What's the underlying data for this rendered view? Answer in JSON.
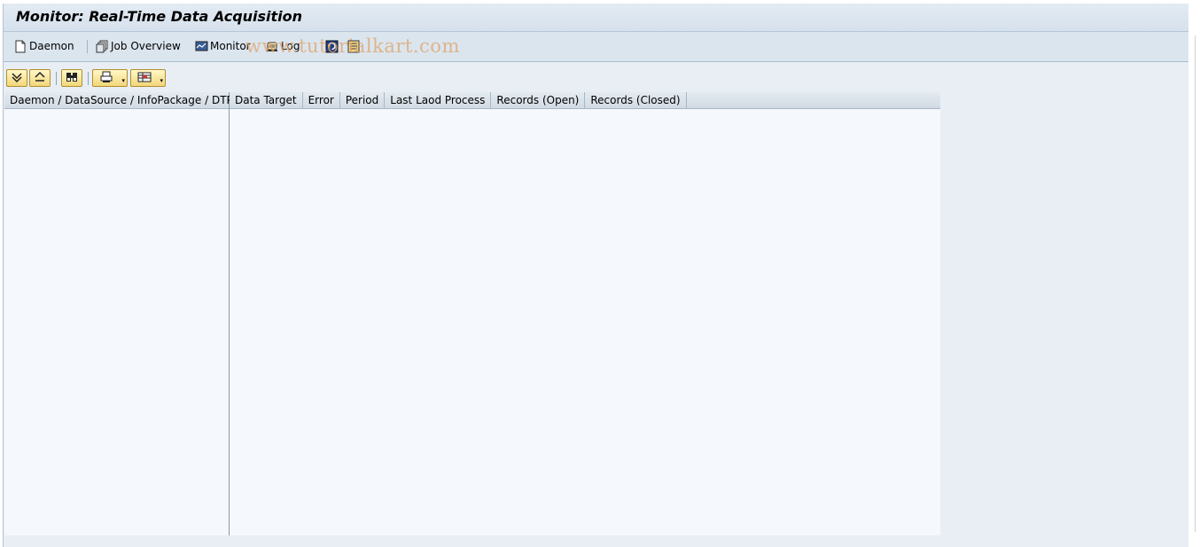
{
  "window": {
    "title": "Monitor: Real-Time Data Acquisition"
  },
  "app_toolbar": {
    "items": [
      {
        "label": "Daemon",
        "icon": "document-icon"
      },
      {
        "label": "Job Overview",
        "icon": "job-overview-icon"
      },
      {
        "label": "Monitor",
        "icon": "monitor-icon"
      },
      {
        "label": "Log",
        "icon": "log-icon"
      },
      {
        "label": "",
        "icon": "refresh-icon"
      },
      {
        "label": "",
        "icon": "list-icon"
      }
    ]
  },
  "watermark": "www.tutorialkart.com",
  "tree": {
    "header": "Daemon / DataSource / InfoPackage / DTP"
  },
  "grid": {
    "columns": [
      "Data Target",
      "Error",
      "Period",
      "Last Laod Process",
      "Records (Open)",
      "Records (Closed)"
    ]
  },
  "colors": {
    "title_bg": "#d6e1ec",
    "toolbar_bg": "#dbe5ee",
    "button_gold": "#f2d77a",
    "content_bg": "#f5f8fc"
  }
}
